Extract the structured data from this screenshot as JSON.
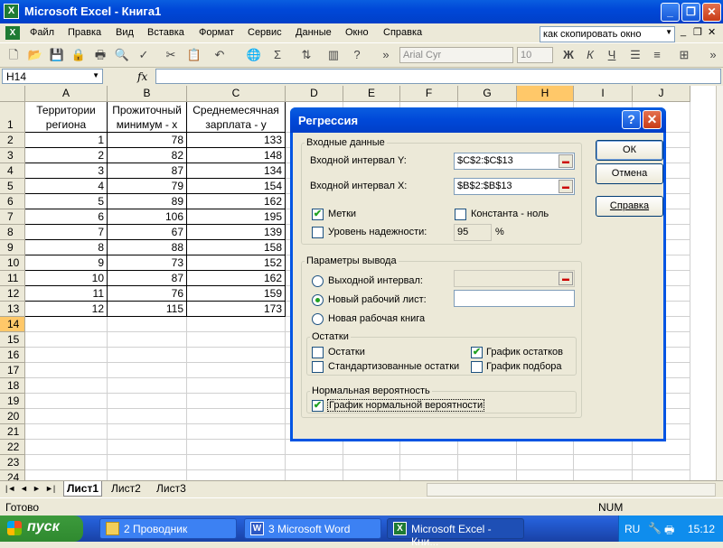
{
  "window": {
    "title": "Microsoft Excel - Книга1",
    "min_glyph": "_",
    "max_glyph": "❐",
    "close_glyph": "✕"
  },
  "menu": {
    "items": [
      "Файл",
      "Правка",
      "Вид",
      "Вставка",
      "Формат",
      "Сервис",
      "Данные",
      "Окно",
      "Справка"
    ],
    "help_box": "как скопировать окно",
    "doc_controls": [
      "_",
      "❐",
      "✕"
    ]
  },
  "toolbar": {
    "font_name": "Arial Cyr",
    "font_size": "10",
    "bold": "Ж",
    "italic": "К",
    "underline": "Ч"
  },
  "formula_bar": {
    "name_box": "H14",
    "fx": "fx",
    "formula": ""
  },
  "sheet": {
    "columns": [
      "A",
      "B",
      "C",
      "D",
      "E",
      "F",
      "G",
      "H",
      "I",
      "J"
    ],
    "selected_column": "H",
    "selected_row": 14,
    "rows": [
      "1",
      "2",
      "3",
      "4",
      "5",
      "6",
      "7",
      "8",
      "9",
      "10",
      "11",
      "12",
      "13",
      "14",
      "15",
      "16",
      "17",
      "18",
      "19",
      "20",
      "21",
      "22",
      "23",
      "24"
    ],
    "headers": [
      "Территории региона",
      "Прожиточный минимум - x",
      "Среднемесячная зарплата - y"
    ],
    "data": [
      [
        1,
        78,
        133
      ],
      [
        2,
        82,
        148
      ],
      [
        3,
        87,
        134
      ],
      [
        4,
        79,
        154
      ],
      [
        5,
        89,
        162
      ],
      [
        6,
        106,
        195
      ],
      [
        7,
        67,
        139
      ],
      [
        8,
        88,
        158
      ],
      [
        9,
        73,
        152
      ],
      [
        10,
        87,
        162
      ],
      [
        11,
        76,
        159
      ],
      [
        12,
        115,
        173
      ]
    ]
  },
  "tabs": {
    "nav": [
      "|◄",
      "◄",
      "►",
      "►|"
    ],
    "sheets": [
      "Лист1",
      "Лист2",
      "Лист3"
    ],
    "active": "Лист1"
  },
  "status": {
    "left": "Готово",
    "num": "NUM"
  },
  "taskbar": {
    "start": "пуск",
    "tasks": [
      "2 Проводник",
      "3 Microsoft Word",
      "Microsoft Excel - Кни..."
    ],
    "lang": "RU",
    "time": "15:12"
  },
  "dialog": {
    "title": "Регрессия",
    "help_glyph": "?",
    "close_glyph": "✕",
    "input_group": "Входные данные",
    "y_label": "Входной интервал Y:",
    "y_value": "$C$2:$C$13",
    "x_label": "Входной интервал X:",
    "x_value": "$B$2:$B$13",
    "labels_chk": "Метки",
    "labels_checked": true,
    "const_chk": "Константа - ноль",
    "const_checked": false,
    "conf_chk": "Уровень надежности:",
    "conf_checked": false,
    "conf_value": "95",
    "conf_unit": "%",
    "output_group": "Параметры вывода",
    "out_range": "Выходной интервал:",
    "out_new_sheet": "Новый рабочий лист:",
    "out_new_book": "Новая рабочая книга",
    "output_selected": "new_sheet",
    "residuals_group": "Остатки",
    "residuals": "Остатки",
    "residuals_checked": false,
    "std_residuals": "Стандартизованные остатки",
    "std_residuals_checked": false,
    "residual_plot": "График остатков",
    "residual_plot_checked": true,
    "fit_plot": "График подбора",
    "fit_plot_checked": false,
    "normal_group": "Нормальная вероятность",
    "normal_plot": "График нормальной вероятности",
    "normal_plot_checked": true,
    "ok": "ОК",
    "cancel": "Отмена",
    "help": "Справка"
  }
}
